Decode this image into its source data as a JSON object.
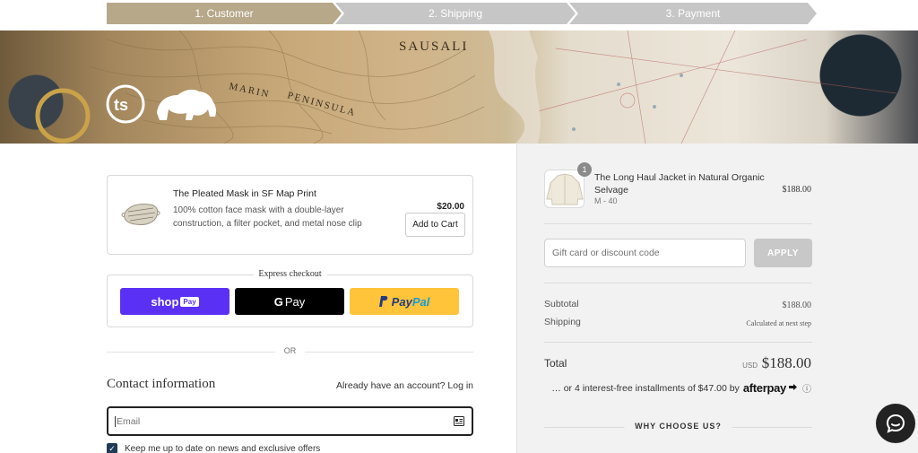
{
  "stepper": {
    "steps": [
      {
        "label": "1. Customer",
        "active": true
      },
      {
        "label": "2. Shipping",
        "active": false
      },
      {
        "label": "3. Payment",
        "active": false
      }
    ],
    "colors": {
      "active": "#b7a88a",
      "inactive": "#c6c6c6"
    }
  },
  "banner": {
    "map_label_1": "SAUSALI",
    "map_label_2": "MARIN",
    "map_label_3": "PENINSULA",
    "logo_monogram": "ts",
    "logo_animal": "bear-icon"
  },
  "upsell": {
    "title": "The Pleated Mask in SF Map Print",
    "description": "100% cotton face mask with a double-layer construction, a filter pocket, and metal nose clip",
    "price": "$20.00",
    "button_label": "Add to Cart"
  },
  "express": {
    "label": "Express checkout",
    "shop_pay": {
      "text": "shop",
      "badge": "Pay",
      "color": "#5a31f4"
    },
    "google_pay": {
      "text": "Pay",
      "g": "G",
      "color": "#000000"
    },
    "paypal": {
      "text_1": "Pay",
      "text_2": "Pal",
      "color": "#ffc439"
    }
  },
  "or_divider": "OR",
  "contact": {
    "title": "Contact information",
    "account_prompt": "Already have an account?",
    "login_link": "Log in",
    "email_placeholder": "Email",
    "newsletter_label": "Keep me up to date on news and exclusive offers",
    "newsletter_checked": true
  },
  "summary": {
    "item": {
      "quantity": "1",
      "name": "The Long Haul Jacket in Natural Organic Selvage",
      "variant": "M - 40",
      "price": "$188.00"
    },
    "discount_placeholder": "Gift card or discount code",
    "apply_label": "APPLY",
    "subtotal_label": "Subtotal",
    "subtotal_value": "$188.00",
    "shipping_label": "Shipping",
    "shipping_value": "Calculated at next step",
    "total_label": "Total",
    "total_currency": "USD",
    "total_value": "$188.00",
    "afterpay_text": "… or 4 interest-free installments of $47.00 by",
    "afterpay_logo": "afterpay",
    "why_choose": "WHY CHOOSE US?"
  },
  "chat": {
    "icon": "chat-icon"
  }
}
